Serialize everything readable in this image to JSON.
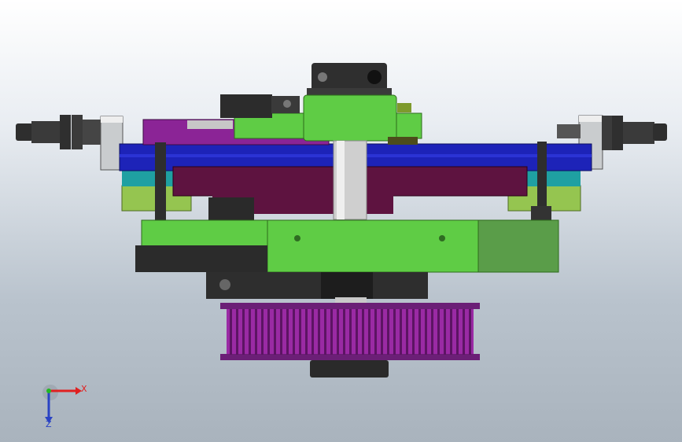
{
  "viewport": {
    "background_top": "#ffffff",
    "background_bottom": "#a9b3bd"
  },
  "model": {
    "icon": "cad-assembly-icon",
    "colors": {
      "green": "#5fcc45",
      "olive": "#95c550",
      "blue": "#1d23b8",
      "maroon": "#5e1340",
      "purple": "#8b2496",
      "teal": "#1fa0a2",
      "dark": "#2c2c2c",
      "gray": "#b9bdc1",
      "metal": "#d6d6d6"
    }
  },
  "triad": {
    "icon": "axis-triad-icon",
    "x_label": "X",
    "z_label": "Z",
    "x_color": "#e02020",
    "y_color": "#23b823",
    "z_color": "#2a43c4"
  }
}
